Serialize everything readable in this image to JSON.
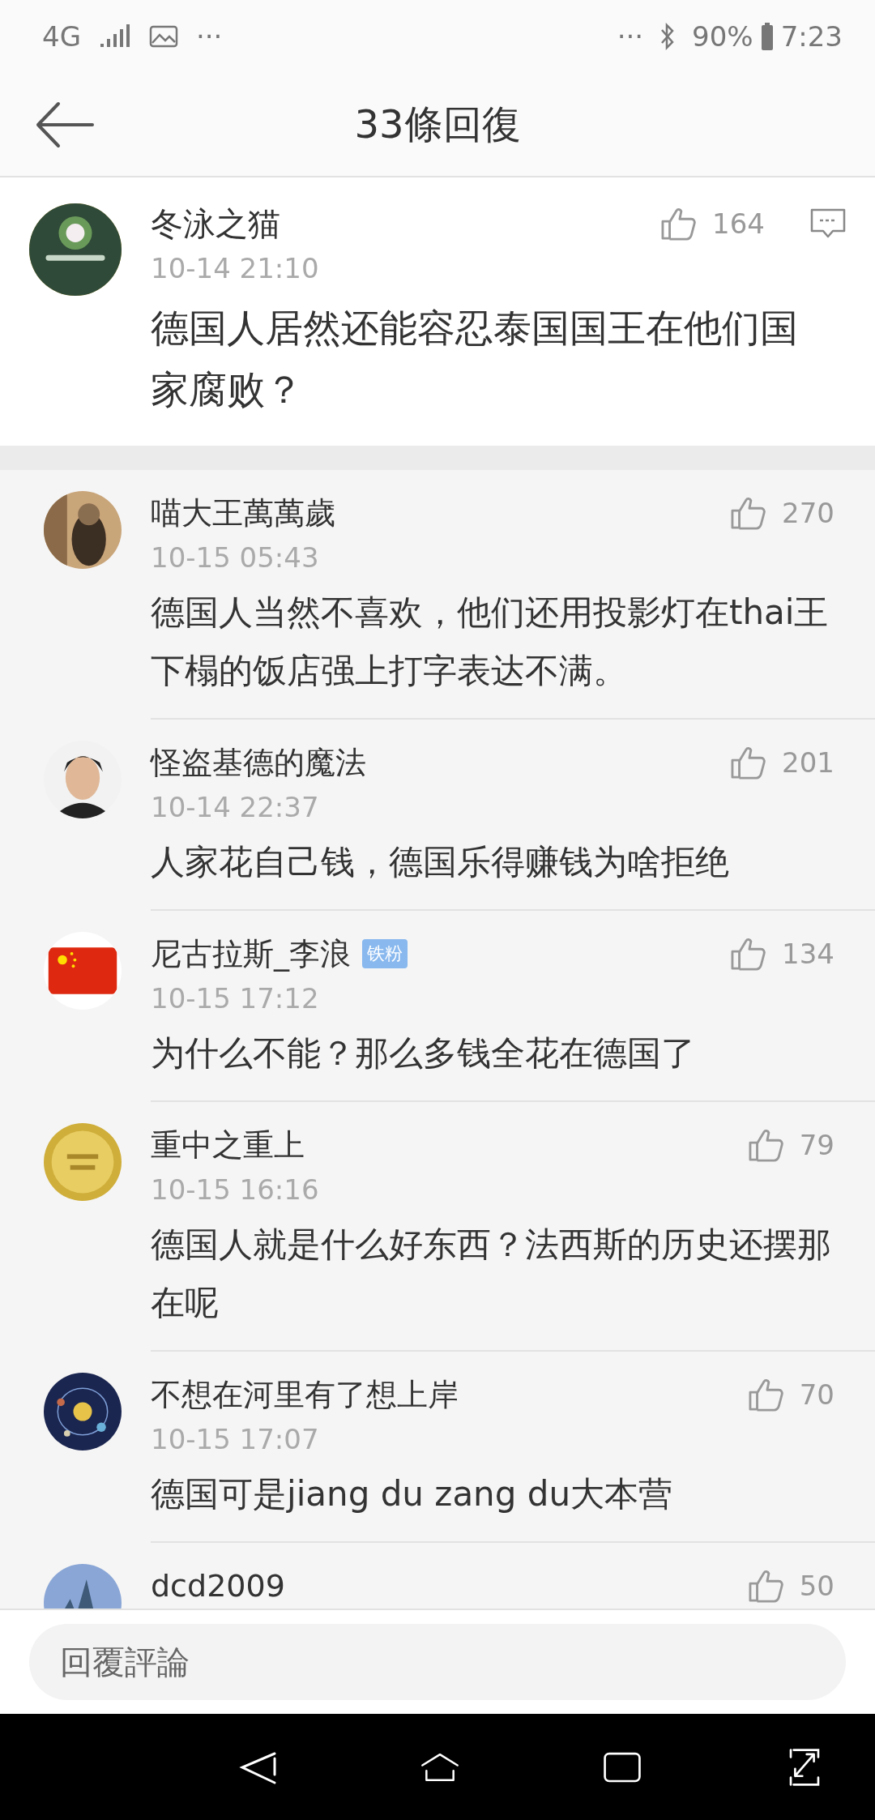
{
  "status_bar": {
    "network": "4G",
    "left_more": "···",
    "right_more": "···",
    "battery_percent": "90%",
    "time": "7:23"
  },
  "header": {
    "title": "33條回復"
  },
  "post": {
    "author": "冬泳之猫",
    "time": "10-14 21:10",
    "likes": "164",
    "text": "德国人居然还能容忍泰国国王在他们国家腐败？"
  },
  "replies": [
    {
      "author": "喵大王萬萬歲",
      "time": "10-15 05:43",
      "likes": "270",
      "text": "德国人当然不喜欢，他们还用投影灯在thai王下榻的饭店强上打字表达不满。"
    },
    {
      "author": "怪盗基德的魔法",
      "time": "10-14 22:37",
      "likes": "201",
      "text": "人家花自己钱，德国乐得赚钱为啥拒绝"
    },
    {
      "author": "尼古拉斯_李浪",
      "badge": "铁粉",
      "time": "10-15 17:12",
      "likes": "134",
      "text": "为什么不能？那么多钱全花在德国了"
    },
    {
      "author": "重中之重上",
      "time": "10-15 16:16",
      "likes": "79",
      "text": "德国人就是什么好东西？法西斯的历史还摆那在呢"
    },
    {
      "author": "不想在河里有了想上岸",
      "time": "10-15 17:07",
      "likes": "70",
      "text": "德国可是jiang du zang du大本营"
    },
    {
      "author": "dcd2009",
      "likes": "50"
    }
  ],
  "reply_box": {
    "placeholder": "回覆評論"
  }
}
